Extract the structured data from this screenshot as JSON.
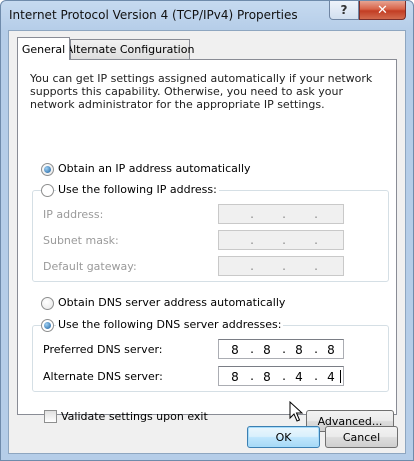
{
  "window": {
    "title": "Internet Protocol Version 4 (TCP/IPv4) Properties",
    "help_label": "?",
    "close_label": "✕"
  },
  "tabs": [
    {
      "label": "General",
      "active": true
    },
    {
      "label": "Alternate Configuration",
      "active": false
    }
  ],
  "general": {
    "description": "You can get IP settings assigned automatically if your network supports this capability. Otherwise, you need to ask your network administrator for the appropriate IP settings.",
    "ip_auto_label": "Obtain an IP address automatically",
    "ip_manual_label": "Use the following IP address:",
    "ip_mode": "auto",
    "ip_fields": [
      {
        "label": "IP address:",
        "octets": [
          "",
          "",
          "",
          ""
        ]
      },
      {
        "label": "Subnet mask:",
        "octets": [
          "",
          "",
          "",
          ""
        ]
      },
      {
        "label": "Default gateway:",
        "octets": [
          "",
          "",
          "",
          ""
        ]
      }
    ],
    "dns_auto_label": "Obtain DNS server address automatically",
    "dns_manual_label": "Use the following DNS server addresses:",
    "dns_mode": "manual",
    "dns_fields": [
      {
        "label": "Preferred DNS server:",
        "octets": [
          "8",
          "8",
          "8",
          "8"
        ]
      },
      {
        "label": "Alternate DNS server:",
        "octets": [
          "8",
          "8",
          "4",
          "4"
        ]
      }
    ],
    "validate_label": "Validate settings upon exit",
    "validate_checked": false,
    "advanced_label": "Advanced..."
  },
  "buttons": {
    "ok_label": "OK",
    "cancel_label": "Cancel"
  }
}
